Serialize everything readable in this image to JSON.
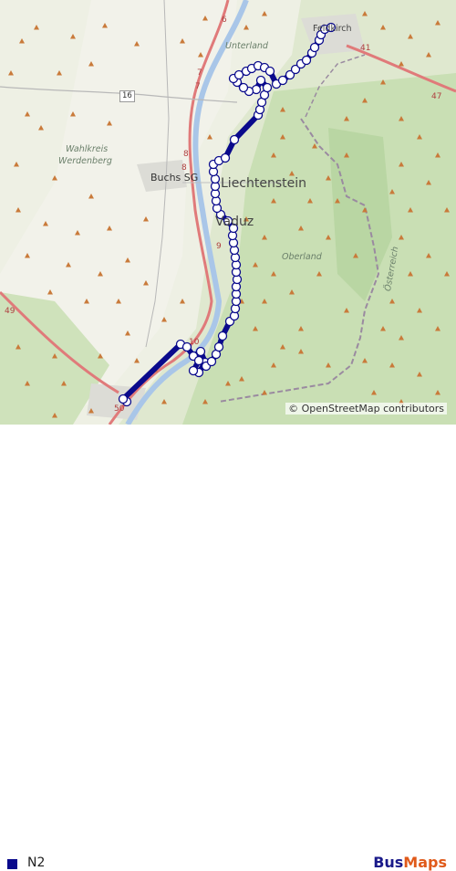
{
  "map": {
    "places": [
      {
        "key": "feldkirch",
        "text": "Feldkirch",
        "cls": "small"
      },
      {
        "key": "unterland",
        "text": "Unterland",
        "cls": "region"
      },
      {
        "key": "wahlkreis",
        "text": "Wahlkreis",
        "cls": "region"
      },
      {
        "key": "werdenberg",
        "text": "Werdenberg",
        "cls": "region"
      },
      {
        "key": "buchs",
        "text": "Buchs SG",
        "cls": "city"
      },
      {
        "key": "liechtenstein",
        "text": "Liechtenstein",
        "cls": "country"
      },
      {
        "key": "vaduz",
        "text": "Vaduz",
        "cls": "country"
      },
      {
        "key": "oberland",
        "text": "Oberland",
        "cls": "region"
      },
      {
        "key": "osterreich",
        "text": "Österreich",
        "cls": "region"
      }
    ],
    "road_numbers": [
      "6",
      "7",
      "7",
      "8",
      "8",
      "9",
      "10",
      "41",
      "47",
      "49",
      "50"
    ],
    "shield": "16",
    "attribution": "© OpenStreetMap contributors",
    "route_color": "#0a0a8c",
    "stops_count": 62
  },
  "legend": {
    "route": "N2",
    "color": "#0a0a8c"
  },
  "logo": {
    "part1": "Bus",
    "part2": "Maps"
  }
}
